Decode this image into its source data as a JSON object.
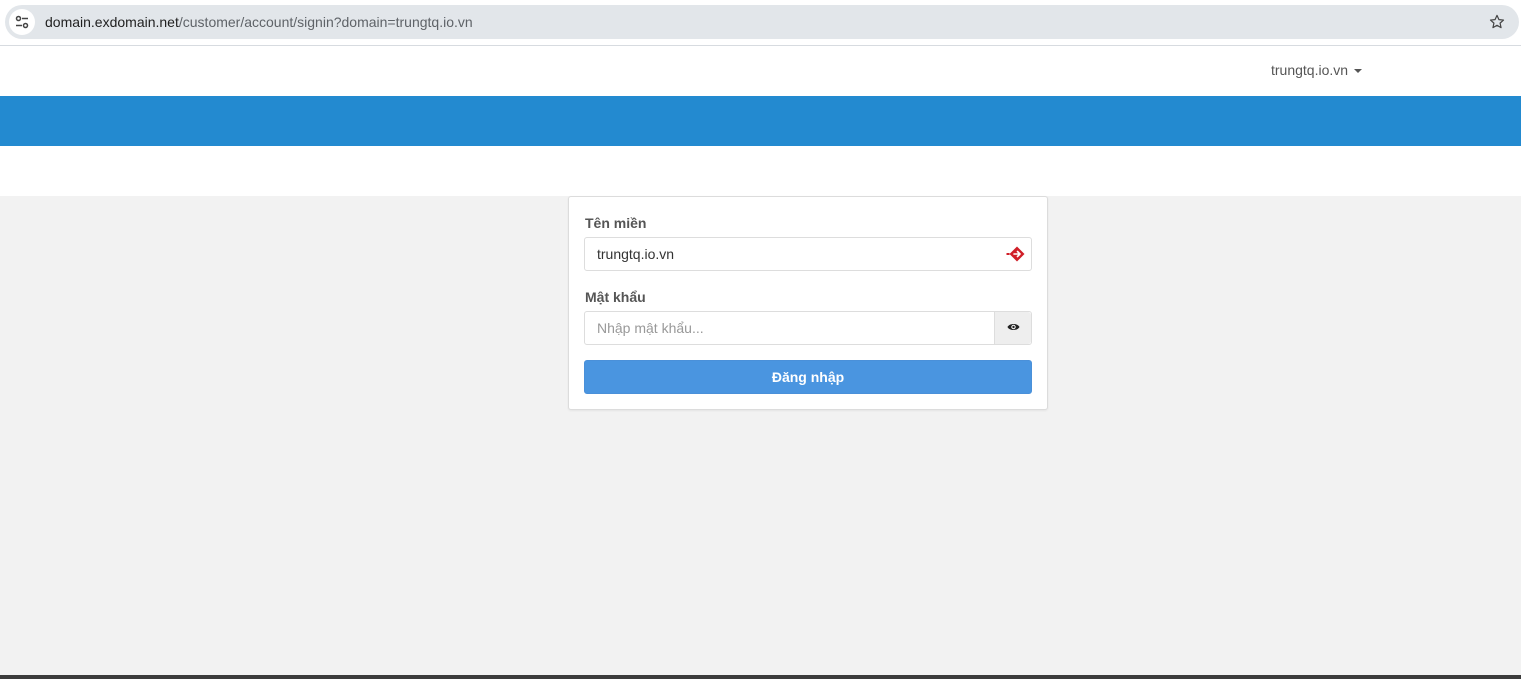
{
  "browser": {
    "url_host": "domain.exdomain.net",
    "url_path": "/customer/account/signin?domain=trungtq.io.vn"
  },
  "header": {
    "domain_menu_label": "trungtq.io.vn"
  },
  "login_form": {
    "domain_label": "Tên miền",
    "domain_value": "trungtq.io.vn",
    "password_label": "Mật khẩu",
    "password_placeholder": "Nhập mật khẩu...",
    "submit_label": "Đăng nhập"
  },
  "colors": {
    "brand_band": "#238ad0",
    "button": "#4a95e0",
    "page_background": "#f2f2f2"
  },
  "icons": {
    "site_info": "tune-icon",
    "bookmark": "star-outline-icon",
    "domain_field": "autofill-key-icon",
    "password_toggle": "eye-icon"
  }
}
